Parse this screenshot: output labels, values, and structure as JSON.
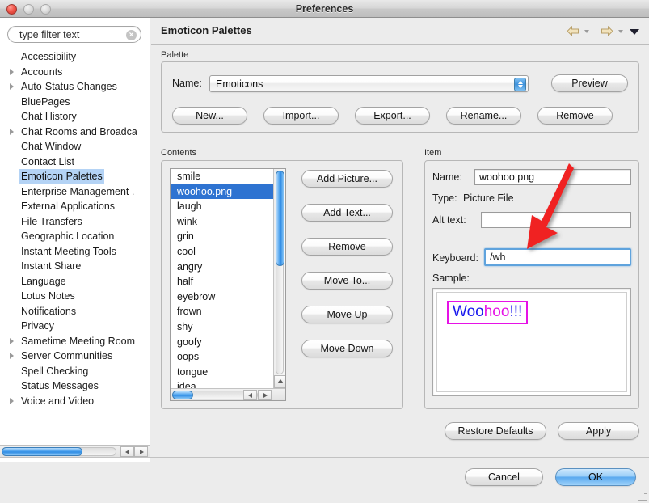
{
  "window": {
    "title": "Preferences",
    "traffic_lights": [
      "close-button",
      "minimize-button",
      "zoom-button"
    ]
  },
  "sidebar": {
    "filter": {
      "value": "type filter text",
      "placeholder": "type filter text",
      "clear_icon": "clear-icon",
      "clear_glyph": "×"
    },
    "items": [
      {
        "label": "Accessibility",
        "expandable": false,
        "selected": false
      },
      {
        "label": "Accounts",
        "expandable": true,
        "selected": false
      },
      {
        "label": "Auto-Status Changes",
        "expandable": true,
        "selected": false
      },
      {
        "label": "BluePages",
        "expandable": false,
        "selected": false
      },
      {
        "label": "Chat History",
        "expandable": false,
        "selected": false
      },
      {
        "label": "Chat Rooms and Broadca",
        "expandable": true,
        "selected": false
      },
      {
        "label": "Chat Window",
        "expandable": false,
        "selected": false
      },
      {
        "label": "Contact List",
        "expandable": false,
        "selected": false
      },
      {
        "label": "Emoticon Palettes",
        "expandable": false,
        "selected": true
      },
      {
        "label": "Enterprise Management .",
        "expandable": false,
        "selected": false
      },
      {
        "label": "External Applications",
        "expandable": false,
        "selected": false
      },
      {
        "label": "File Transfers",
        "expandable": false,
        "selected": false
      },
      {
        "label": "Geographic Location",
        "expandable": false,
        "selected": false
      },
      {
        "label": "Instant Meeting Tools",
        "expandable": false,
        "selected": false
      },
      {
        "label": "Instant Share",
        "expandable": false,
        "selected": false
      },
      {
        "label": "Language",
        "expandable": false,
        "selected": false
      },
      {
        "label": "Lotus Notes",
        "expandable": false,
        "selected": false
      },
      {
        "label": "Notifications",
        "expandable": false,
        "selected": false
      },
      {
        "label": "Privacy",
        "expandable": false,
        "selected": false
      },
      {
        "label": "Sametime Meeting Room",
        "expandable": true,
        "selected": false
      },
      {
        "label": "Server Communities",
        "expandable": true,
        "selected": false
      },
      {
        "label": "Spell Checking",
        "expandable": false,
        "selected": false
      },
      {
        "label": "Status Messages",
        "expandable": false,
        "selected": false
      },
      {
        "label": "Voice and Video",
        "expandable": true,
        "selected": false
      }
    ]
  },
  "pane": {
    "title": "Emoticon Palettes",
    "nav": {
      "back_icon": "back-arrow-icon",
      "back_menu_icon": "chevron-down-icon",
      "forward_icon": "forward-arrow-icon",
      "forward_menu_icon": "chevron-down-icon",
      "menu_icon": "chevron-down-icon"
    }
  },
  "palette": {
    "group_label": "Palette",
    "name_label": "Name:",
    "name_value": "Emoticons",
    "stepper_icon": "stepper-updown-icon",
    "preview_label": "Preview",
    "buttons": [
      {
        "label": "New...",
        "name": "new-palette-button"
      },
      {
        "label": "Import...",
        "name": "import-palette-button"
      },
      {
        "label": "Export...",
        "name": "export-palette-button"
      },
      {
        "label": "Rename...",
        "name": "rename-palette-button"
      },
      {
        "label": "Remove",
        "name": "remove-palette-button"
      }
    ]
  },
  "contents": {
    "group_label": "Contents",
    "items": [
      {
        "label": "smile",
        "selected": false
      },
      {
        "label": "woohoo.png",
        "selected": true
      },
      {
        "label": "laugh",
        "selected": false
      },
      {
        "label": "wink",
        "selected": false
      },
      {
        "label": "grin",
        "selected": false
      },
      {
        "label": "cool",
        "selected": false
      },
      {
        "label": "angry",
        "selected": false
      },
      {
        "label": "half",
        "selected": false
      },
      {
        "label": "eyebrow",
        "selected": false
      },
      {
        "label": "frown",
        "selected": false
      },
      {
        "label": "shy",
        "selected": false
      },
      {
        "label": "goofy",
        "selected": false
      },
      {
        "label": "oops",
        "selected": false
      },
      {
        "label": "tongue",
        "selected": false
      },
      {
        "label": "idea",
        "selected": false
      }
    ],
    "actions": [
      {
        "label": "Add Picture...",
        "name": "add-picture-button"
      },
      {
        "label": "Add Text...",
        "name": "add-text-button"
      },
      {
        "label": "Remove",
        "name": "remove-item-button"
      },
      {
        "label": "Move To...",
        "name": "move-to-button"
      },
      {
        "label": "Move Up",
        "name": "move-up-button"
      },
      {
        "label": "Move Down",
        "name": "move-down-button"
      }
    ]
  },
  "item": {
    "group_label": "Item",
    "name_label": "Name:",
    "name_value": "woohoo.png",
    "type_label": "Type:",
    "type_value": "Picture File",
    "alt_label": "Alt text:",
    "alt_value": "",
    "keyboard_label": "Keyboard:",
    "keyboard_value": "/wh",
    "sample_label": "Sample:",
    "sample": {
      "parts": [
        {
          "text": "Woo",
          "color": "#1a1aee"
        },
        {
          "text": "hoo",
          "color": "#e612e6"
        },
        {
          "text": "!!!",
          "color": "#1a1aee"
        }
      ],
      "border_color": "#e612e6"
    }
  },
  "footer": {
    "restore_defaults_label": "Restore Defaults",
    "apply_label": "Apply",
    "cancel_label": "Cancel",
    "ok_label": "OK"
  },
  "annotation": {
    "arrow_color": "#f02020",
    "arrow_name": "red-pointer-arrow"
  },
  "colors": {
    "selection_blue": "#2e73d1",
    "tree_selection": "#b4d3f5",
    "focus_blue": "#5fa3dd",
    "magenta": "#e612e6",
    "blue_text": "#1a1aee"
  }
}
